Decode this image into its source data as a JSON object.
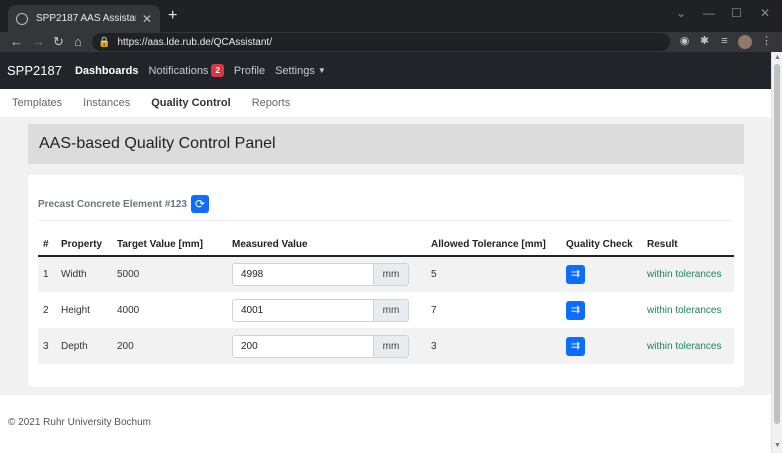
{
  "browser": {
    "tab_title": "SPP2187 AAS Assistant",
    "url": "https://aas.lde.rub.de/QCAssistant/"
  },
  "navbar": {
    "brand": "SPP2187",
    "items": [
      {
        "label": "Dashboards",
        "active": true
      },
      {
        "label": "Notifications",
        "badge": "2"
      },
      {
        "label": "Profile"
      },
      {
        "label": "Settings"
      }
    ]
  },
  "subnav": {
    "items": [
      "Templates",
      "Instances",
      "Quality Control",
      "Reports"
    ],
    "active": "Quality Control"
  },
  "panel": {
    "title": "AAS-based Quality Control Panel"
  },
  "element": {
    "name": "Precast Concrete Element #123"
  },
  "table": {
    "headers": [
      "#",
      "Property",
      "Target Value [mm]",
      "Measured Value",
      "Allowed Tolerance [mm]",
      "Quality Check",
      "Result"
    ],
    "rows": [
      {
        "num": "1",
        "property": "Width",
        "target": "5000",
        "measured": "4998",
        "unit": "mm",
        "tolerance": "5",
        "result": "within tolerances"
      },
      {
        "num": "2",
        "property": "Height",
        "target": "4000",
        "measured": "4001",
        "unit": "mm",
        "tolerance": "7",
        "result": "within tolerances"
      },
      {
        "num": "3",
        "property": "Depth",
        "target": "200",
        "measured": "200",
        "unit": "mm",
        "tolerance": "3",
        "result": "within tolerances"
      }
    ]
  },
  "footer": {
    "text": "© 2021 Ruhr University Bochum"
  },
  "colors": {
    "navbar_bg": "#212529",
    "primary": "#0d6efd",
    "success": "#198754",
    "badge": "#dc3545"
  }
}
